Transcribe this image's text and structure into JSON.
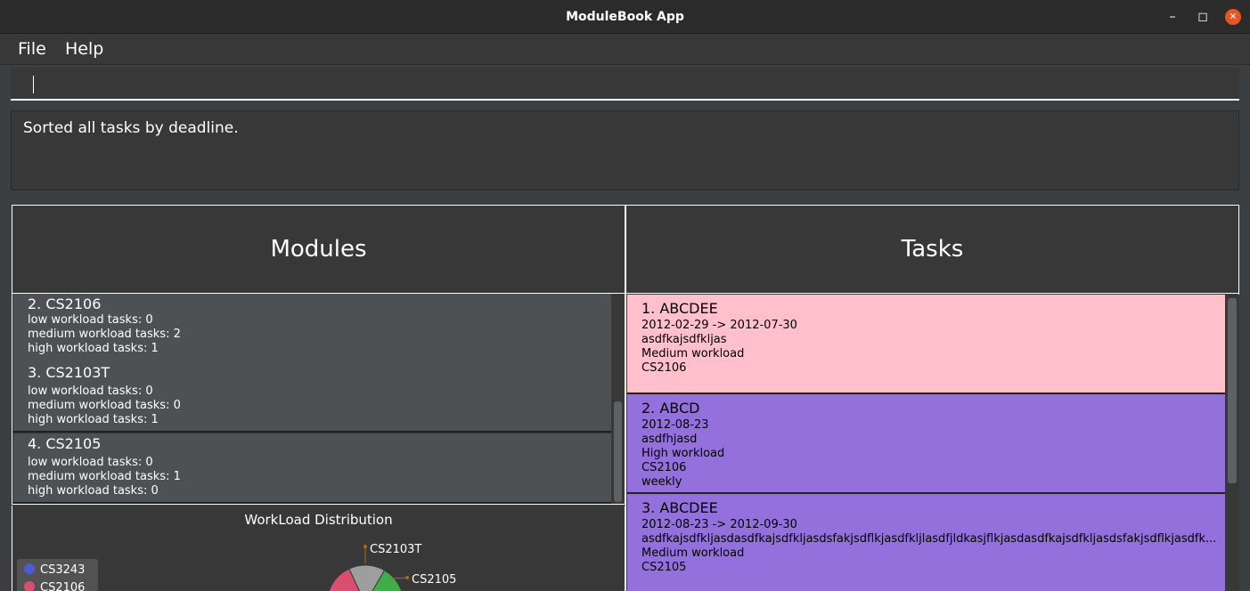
{
  "window": {
    "title": "ModuleBook App"
  },
  "menu": {
    "file": "File",
    "help": "Help"
  },
  "command": {
    "value": "",
    "placeholder": ""
  },
  "result": {
    "message": "Sorted all tasks by deadline."
  },
  "modules": {
    "header": "Modules",
    "items": [
      {
        "name": "2.  CS2106",
        "low": "low workload tasks: 0",
        "medium": "medium workload tasks: 2",
        "high": "high workload tasks: 1"
      },
      {
        "name": "3.  CS2103T",
        "low": "low workload tasks: 0",
        "medium": "medium workload tasks: 0",
        "high": "high workload tasks: 1"
      },
      {
        "name": "4.  CS2105",
        "low": "low workload tasks: 0",
        "medium": "medium workload tasks: 1",
        "high": "high workload tasks: 0"
      }
    ]
  },
  "tasks": {
    "header": "Tasks",
    "items": [
      {
        "name": "1.  ABCDEE",
        "date": "2012-02-29 -> 2012-07-30",
        "description": "asdfkajsdfkljas",
        "workload": "Medium workload",
        "module": "CS2106",
        "recurrence": "",
        "color": "#ffbfcb"
      },
      {
        "name": "2.  ABCD",
        "date": "2012-08-23",
        "description": "asdfhjasd",
        "workload": "High workload",
        "module": "CS2106",
        "recurrence": "weekly",
        "color": "#9370db"
      },
      {
        "name": "3.  ABCDEE",
        "date": "2012-08-23 -> 2012-09-30",
        "description": "asdfkajsdfkljasdasdfkajsdfkljasdsfakjsdflkjasdfkljlasdfjldkasjflkjasdasdfkajsdfkljasdsfakjsdflkjasdfk...",
        "workload": "Medium workload",
        "module": "CS2105",
        "recurrence": "",
        "color": "#9370db"
      }
    ]
  },
  "chart": {
    "title": "WorkLoad Distribution",
    "legend": [
      {
        "label": "CS3243",
        "color": "#4a5bd4"
      },
      {
        "label": "CS2106",
        "color": "#d94f6e"
      }
    ],
    "labels": {
      "cs2103t": "CS2103T",
      "cs2105": "CS2105"
    }
  },
  "chart_data": {
    "type": "pie",
    "title": "WorkLoad Distribution",
    "series": [
      {
        "name": "CS3243",
        "color": "#4a5bd4"
      },
      {
        "name": "CS2106",
        "color": "#d94f6e"
      },
      {
        "name": "CS2103T",
        "color": "#9e9e9e"
      },
      {
        "name": "CS2105",
        "color": "#3fae49"
      }
    ],
    "legend_position": "bottom-left"
  }
}
